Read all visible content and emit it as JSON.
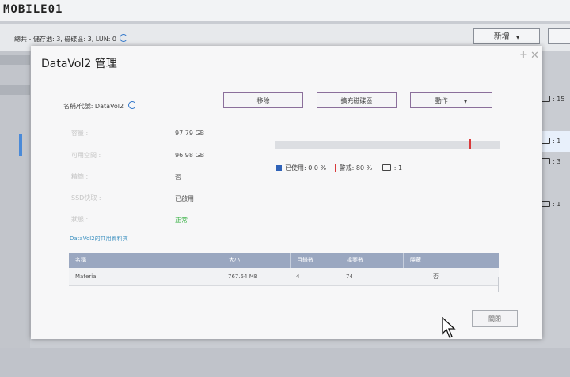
{
  "watermark": {
    "logo": "MOBILE01"
  },
  "background": {
    "summary": "總共 - 儲存池: 3, 磁碟區: 3, LUN: 0",
    "new_button": "新增",
    "right_rows": [
      "15",
      "1",
      "3",
      "1"
    ]
  },
  "modal": {
    "title": "DataVol2 管理",
    "name_label": "名稱/代號: DataVol2",
    "buttons": {
      "remove": "移除",
      "expand": "擴充磁碟區",
      "action": "動作"
    },
    "properties": [
      {
        "label": "容量 :",
        "value": "97.79 GB"
      },
      {
        "label": "可用空間 :",
        "value": "96.98 GB"
      },
      {
        "label": "精簡 :",
        "value": "否"
      },
      {
        "label": "SSD快取 :",
        "value": "已啟用"
      },
      {
        "label": "狀態 :",
        "value": "正常"
      }
    ],
    "usage": {
      "used_label": "已使用: 0.0 %",
      "warn_label": "警戒: 80 %",
      "snapshots": "1",
      "used_fraction": 0.0,
      "warn_fraction": 0.8
    },
    "shared_title": "DataVol2的共用資料夾",
    "table": {
      "headers": [
        "名稱",
        "大小",
        "目錄數",
        "檔案數",
        "隱藏"
      ],
      "rows": [
        [
          "Material",
          "767.54 MB",
          "4",
          "74",
          "否"
        ]
      ]
    },
    "close_label": "關閉"
  }
}
